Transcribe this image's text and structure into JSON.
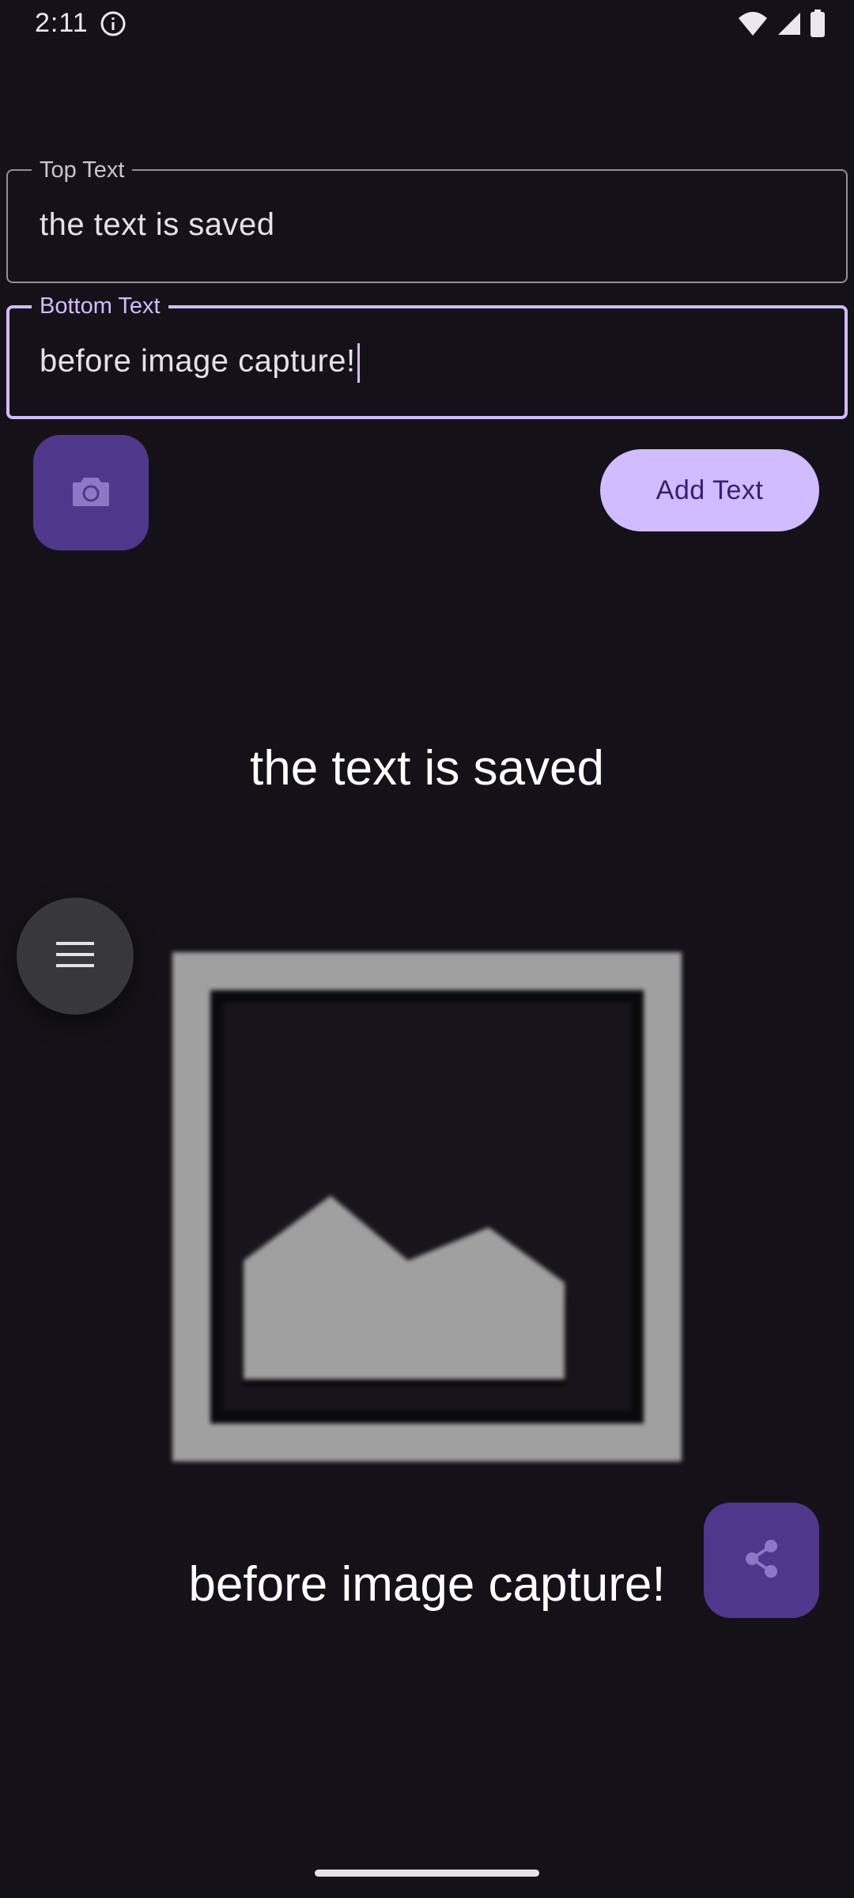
{
  "status_bar": {
    "time": "2:11",
    "icons": [
      "info-icon",
      "wifi-icon",
      "signal-icon",
      "battery-icon"
    ]
  },
  "top_field": {
    "label": "Top Text",
    "value": "the text is saved"
  },
  "bottom_field": {
    "label": "Bottom Text",
    "value": "before image capture!"
  },
  "buttons": {
    "camera_icon": "camera-icon",
    "add_text": "Add Text",
    "menu_icon": "menu-icon",
    "share_icon": "share-icon"
  },
  "meme": {
    "top_text": "the text is saved",
    "bottom_text": "before image capture!",
    "image_icon": "image-placeholder-icon"
  },
  "colors": {
    "background": "#141218",
    "primary": "#D0BCFF",
    "primary_container": "#4F378B",
    "on_primary": "#381E72",
    "outline": "#938F99",
    "placeholder_gray": "#A0A0A0"
  }
}
